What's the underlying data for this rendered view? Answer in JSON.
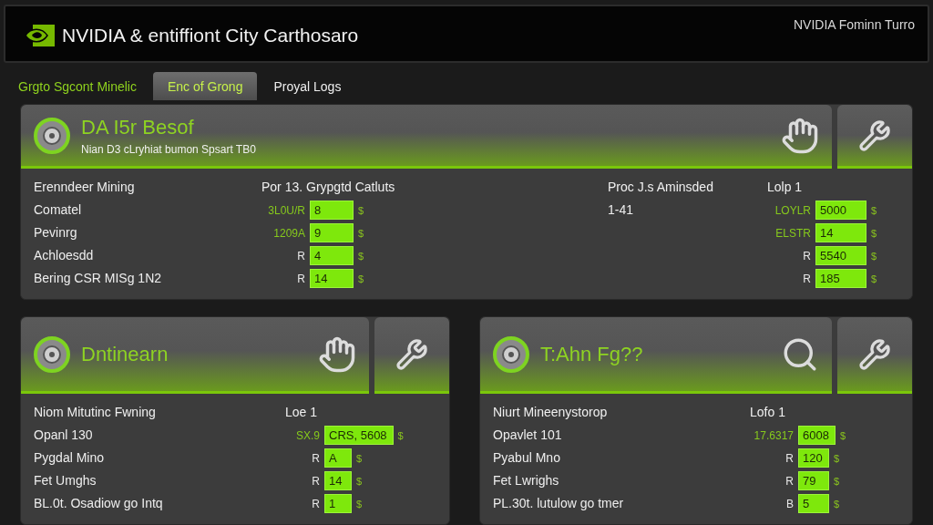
{
  "header": {
    "title": "NVIDIA & entiffiont City Carthosaro",
    "right_text": "NVIDIA Fominn Turro"
  },
  "tabs": [
    {
      "label": "Grgto Sgcont Minelic",
      "selected": false
    },
    {
      "label": "Enc of Grong",
      "selected": true
    },
    {
      "label": "Proyal Logs",
      "selected": false
    }
  ],
  "panels": [
    {
      "title": "DA I5r Besof",
      "subtitle": "Nian D3 cLryhiat bumon Spsart TB0",
      "kind": "hand",
      "columns": [
        {
          "heading": "Erenndeer Mining",
          "rows": [
            {
              "kind": "text",
              "text": "Comatel"
            },
            {
              "kind": "text",
              "text": "Pevinrg"
            },
            {
              "kind": "text",
              "text": "Achloesdd"
            },
            {
              "kind": "text",
              "text": "Bering CSR MISg 1N2"
            }
          ]
        },
        {
          "heading": "Por 13. Grypgtd Catluts",
          "rows": [
            {
              "kind": "bar",
              "prefix": "3L0U/R",
              "highlighted": true,
              "value": "8",
              "unit": "$"
            },
            {
              "kind": "bar",
              "prefix": "1209A",
              "highlighted": true,
              "value": "9",
              "unit": "$"
            },
            {
              "kind": "bar",
              "prefix": "R",
              "highlighted": false,
              "value": "4",
              "unit": "$"
            },
            {
              "kind": "bar",
              "prefix": "R",
              "highlighted": false,
              "value": "14",
              "unit": "$"
            }
          ]
        },
        {
          "heading": "Proc J.s Aminsded",
          "rows": [
            {
              "kind": "text",
              "text": "1-41"
            }
          ]
        },
        {
          "heading": "Lolp 1",
          "rows": [
            {
              "kind": "bar",
              "prefix": "LOYLR",
              "highlighted": true,
              "value": "5000",
              "unit": "$"
            },
            {
              "kind": "bar",
              "prefix": "ELSTR",
              "highlighted": true,
              "value": "14",
              "unit": "$"
            },
            {
              "kind": "bar",
              "prefix": "R",
              "highlighted": false,
              "value": "5540",
              "unit": "$"
            },
            {
              "kind": "bar",
              "prefix": "R",
              "highlighted": false,
              "value": "185",
              "unit": "$"
            }
          ]
        }
      ]
    },
    {
      "title": "Dntinearn",
      "kind": "hand",
      "columns": [
        {
          "heading": "Niom Mitutinc Fwning",
          "rows": [
            {
              "kind": "text",
              "text": "Opanl 130"
            },
            {
              "kind": "text",
              "text": "Pygdal Mino"
            },
            {
              "kind": "text",
              "text": "Fet Umghs"
            },
            {
              "kind": "text",
              "text": "BL.0t. Osadiow go Intq"
            }
          ]
        },
        {
          "heading": "Loe 1",
          "rows": [
            {
              "kind": "bar",
              "prefix": "SX.9",
              "highlighted": true,
              "value": "CRS, 5608",
              "unit": "$"
            },
            {
              "kind": "bar",
              "prefix": "R",
              "highlighted": false,
              "value": "A",
              "unit": "$"
            },
            {
              "kind": "bar",
              "prefix": "R",
              "highlighted": false,
              "value": "14",
              "unit": "$"
            },
            {
              "kind": "bar",
              "prefix": "R",
              "highlighted": false,
              "value": "1",
              "unit": "$"
            }
          ]
        }
      ]
    },
    {
      "title": "T:Ahn Fg??",
      "kind": "search",
      "columns": [
        {
          "heading": "Niurt Mineenystorop",
          "rows": [
            {
              "kind": "text",
              "text": "Opavlet 101"
            },
            {
              "kind": "text",
              "text": "Pyabul Mno"
            },
            {
              "kind": "text",
              "text": "Fet Lwrighs"
            },
            {
              "kind": "text",
              "text": "PL.30t. lutulow go tmer"
            }
          ]
        },
        {
          "heading": "Lofo 1",
          "rows": [
            {
              "kind": "bar",
              "prefix": "17.6317",
              "highlighted": true,
              "value": "6008",
              "unit": "$"
            },
            {
              "kind": "bar",
              "prefix": "R",
              "highlighted": false,
              "value": "120",
              "unit": "$"
            },
            {
              "kind": "bar",
              "prefix": "R",
              "highlighted": false,
              "value": "79",
              "unit": "$"
            },
            {
              "kind": "bar",
              "prefix": "B",
              "highlighted": false,
              "value": "5",
              "unit": "$"
            }
          ]
        }
      ]
    }
  ]
}
